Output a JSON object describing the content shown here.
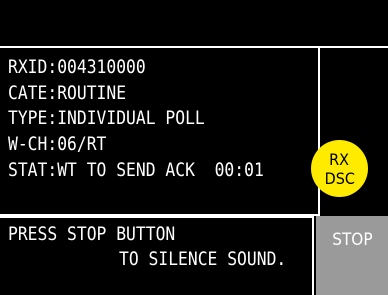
{
  "status_panel": {
    "rxid": "RXID:004310000",
    "category": "CATE:ROUTINE",
    "type": "TYPE:INDIVIDUAL POLL",
    "work_channel": "W-CH:06/RT",
    "status": "STAT:WT TO SEND ACK  00:01"
  },
  "rx_badge": {
    "line1": "RX",
    "line2": "DSC",
    "color": "#ffeb00"
  },
  "message": {
    "line1": "PRESS STOP BUTTON",
    "line2": "TO SILENCE SOUND."
  },
  "stop_button": {
    "label": "STOP",
    "color": "#9a9a9a"
  }
}
